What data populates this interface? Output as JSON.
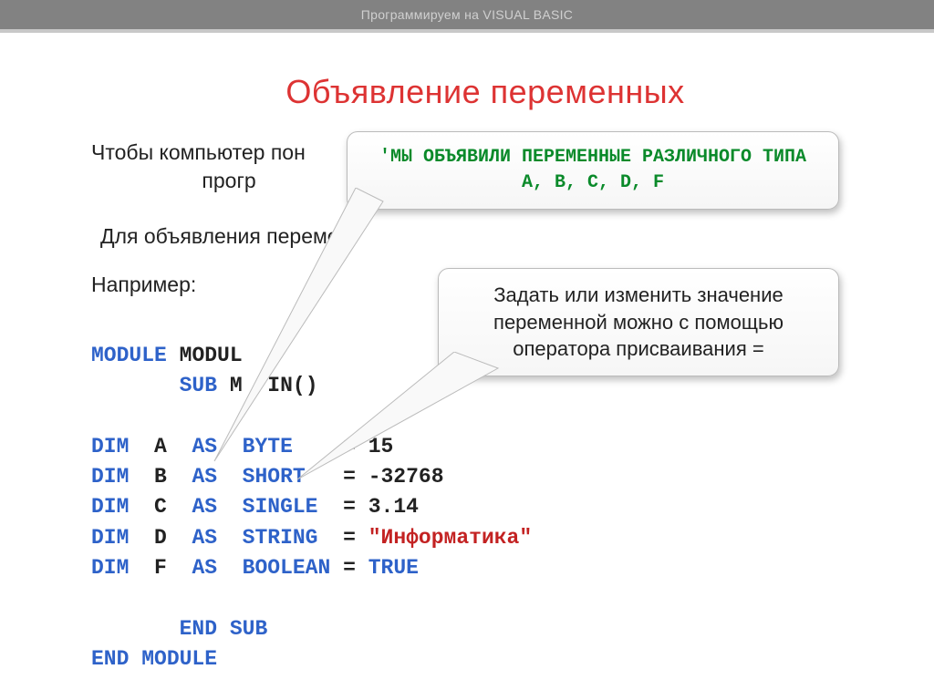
{
  "header": {
    "title": "Программируем на VISUAL BASIC"
  },
  "slide": {
    "title": "Объявление переменных",
    "line1a": "Чтобы компьютер пон",
    "line1b": "прогр",
    "line2": "Для объявления перемен",
    "example_label": "Например:"
  },
  "bubble1": {
    "line1": "'МЫ ОБЪЯВИЛИ ПЕРЕМЕННЫЕ РАЗЛИЧНОГО ТИПА",
    "line2": "A, B, C, D, F"
  },
  "bubble2": {
    "text": "Задать или изменить значение переменной можно с помощью оператора присваивания  ="
  },
  "code": {
    "module": "MODULE",
    "modname": "MODUL",
    "sub": "SUB",
    "main_partial": "M",
    "main_suffix": "IN()",
    "dim": "DIM",
    "as": "AS",
    "vA": "A",
    "tA": "BYTE",
    "valA": "15",
    "vB": "B",
    "tB": "SHORT",
    "valB": "-32768",
    "vC": "C",
    "tC": "SINGLE",
    "valC": "3.14",
    "vD": "D",
    "tD": "STRING",
    "valD": "\"Информатика\"",
    "vF": "F",
    "tF": "BOOLEAN",
    "valF": "TRUE",
    "endsub": "END SUB",
    "endmod": "END MODULE"
  }
}
